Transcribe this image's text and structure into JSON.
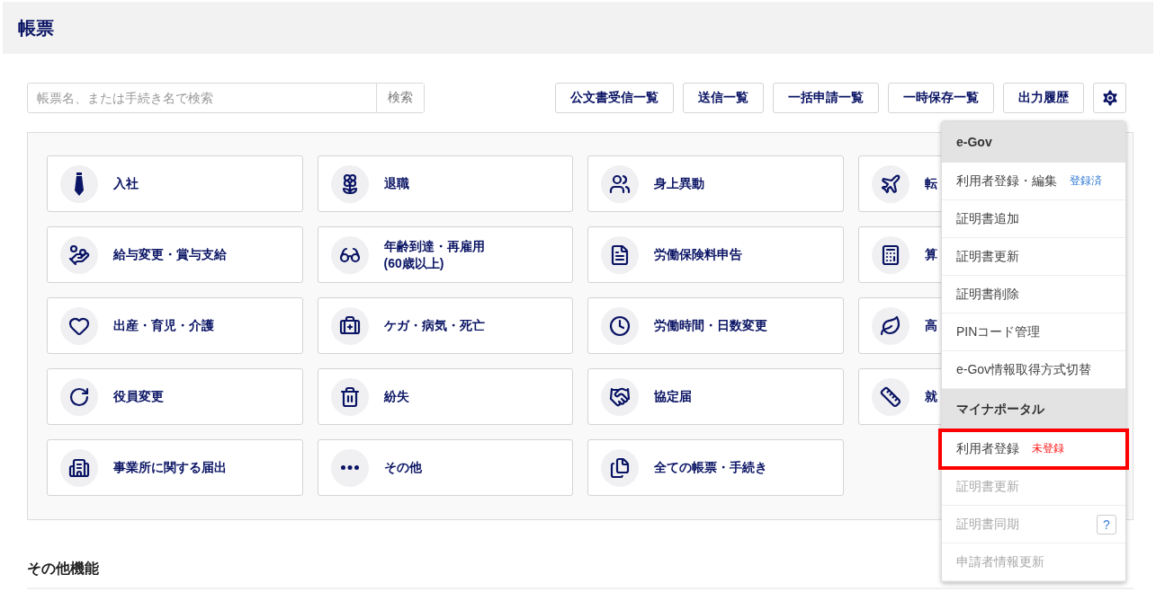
{
  "header": {
    "title": "帳票"
  },
  "search": {
    "placeholder": "帳票名、または手続き名で検索",
    "button": "検索"
  },
  "toolbar": [
    "公文書受信一覧",
    "送信一覧",
    "一括申請一覧",
    "一時保存一覧",
    "出力履歴"
  ],
  "card_rows": [
    {
      "cards": [
        {
          "label": "入社"
        },
        {
          "label": "退職"
        },
        {
          "label": "身上異動"
        },
        {
          "label": "転"
        }
      ]
    },
    {
      "cards": [
        {
          "label": "給与変更・賞与支給"
        },
        {
          "label": "年齢到達・再雇用\n(60歳以上)"
        },
        {
          "label": "労働保険料申告"
        },
        {
          "label": "算"
        }
      ]
    },
    {
      "cards": [
        {
          "label": "出産・育児・介護"
        },
        {
          "label": "ケガ・病気・死亡"
        },
        {
          "label": "労働時間・日数変更"
        },
        {
          "label": "高"
        }
      ]
    },
    {
      "cards": [
        {
          "label": "役員変更"
        },
        {
          "label": "紛失"
        },
        {
          "label": "協定届"
        },
        {
          "label": "就"
        }
      ]
    },
    {
      "cards": [
        {
          "label": "事業所に関する届出"
        },
        {
          "label": "その他"
        },
        {
          "label": "全ての帳票・手続き"
        }
      ]
    }
  ],
  "settings_menu": [
    {
      "kind": "header",
      "label": "e-Gov"
    },
    {
      "kind": "item",
      "label": "利用者登録・編集",
      "status": "登録済",
      "registered": true,
      "disabled": false,
      "highlighted": false
    },
    {
      "kind": "item",
      "label": "証明書追加",
      "disabled": false,
      "highlighted": false
    },
    {
      "kind": "item",
      "label": "証明書更新",
      "disabled": false,
      "highlighted": false
    },
    {
      "kind": "item",
      "label": "証明書削除",
      "disabled": false,
      "highlighted": false
    },
    {
      "kind": "item",
      "label": "PINコード管理",
      "disabled": false,
      "highlighted": false
    },
    {
      "kind": "item",
      "label": "e-Gov情報取得方式切替",
      "disabled": false,
      "highlighted": false
    },
    {
      "kind": "header",
      "label": "マイナポータル"
    },
    {
      "kind": "item",
      "label": "利用者登録",
      "status": "未登録",
      "registered": false,
      "disabled": false,
      "highlighted": true
    },
    {
      "kind": "item",
      "label": "証明書更新",
      "disabled": true,
      "highlighted": false
    },
    {
      "kind": "item",
      "label": "証明書同期",
      "disabled": true,
      "highlighted": false,
      "help": "?"
    },
    {
      "kind": "item",
      "label": "申請者情報更新",
      "disabled": true,
      "highlighted": false
    }
  ],
  "section": {
    "title": "その他機能"
  }
}
